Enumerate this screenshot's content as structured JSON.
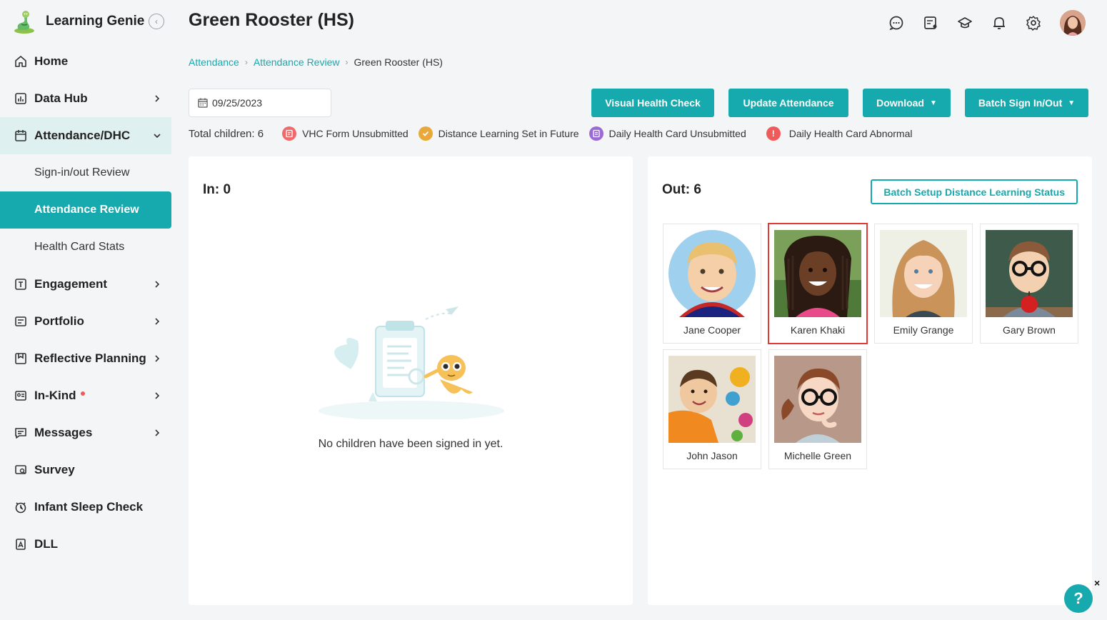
{
  "app": {
    "name": "Learning Genie"
  },
  "sidebar": {
    "items": [
      {
        "label": "Home",
        "icon": "home-icon"
      },
      {
        "label": "Data Hub",
        "icon": "chart-icon"
      },
      {
        "label": "Attendance/DHC",
        "icon": "calendar-icon"
      },
      {
        "label": "Engagement",
        "icon": "engagement-icon"
      },
      {
        "label": "Portfolio",
        "icon": "portfolio-icon"
      },
      {
        "label": "Reflective Planning",
        "icon": "planning-icon"
      },
      {
        "label": "In-Kind",
        "icon": "inkind-icon"
      },
      {
        "label": "Messages",
        "icon": "messages-icon"
      },
      {
        "label": "Survey",
        "icon": "survey-icon"
      },
      {
        "label": "Infant Sleep Check",
        "icon": "clock-icon"
      },
      {
        "label": "DLL",
        "icon": "dll-icon"
      }
    ],
    "subitems": [
      {
        "label": "Sign-in/out Review"
      },
      {
        "label": "Attendance Review"
      },
      {
        "label": "Health Card Stats"
      }
    ]
  },
  "header": {
    "title": "Green Rooster (HS)"
  },
  "breadcrumb": {
    "items": [
      "Attendance",
      "Attendance Review",
      "Green Rooster (HS)"
    ]
  },
  "toolbar": {
    "date": "09/25/2023",
    "visual_health_check": "Visual Health Check",
    "update_attendance": "Update Attendance",
    "download": "Download",
    "batch_sign": "Batch Sign In/Out"
  },
  "legend": {
    "total": "Total children: 6",
    "items": [
      {
        "label": "VHC Form Unsubmitted",
        "color": "#ef6b6b"
      },
      {
        "label": "Distance Learning Set in Future",
        "color": "#e8a93a"
      },
      {
        "label": "Daily Health Card Unsubmitted",
        "color": "#9b6ad6"
      },
      {
        "label": "Daily Health Card Abnormal",
        "color": "#ef5b5b"
      }
    ]
  },
  "panel_in": {
    "title": "In: 0",
    "empty_text": "No children have been signed in yet."
  },
  "panel_out": {
    "title": "Out: 6",
    "batch_setup": "Batch Setup Distance Learning Status",
    "children": [
      {
        "name": "Jane Cooper"
      },
      {
        "name": "Karen Khaki"
      },
      {
        "name": "Emily Grange"
      },
      {
        "name": "Gary Brown"
      },
      {
        "name": "John Jason"
      },
      {
        "name": "Michelle Green"
      }
    ]
  },
  "help": {
    "label": "?",
    "close": "×"
  },
  "colors": {
    "accent": "#16a9ad",
    "selected_border": "#e53935"
  }
}
